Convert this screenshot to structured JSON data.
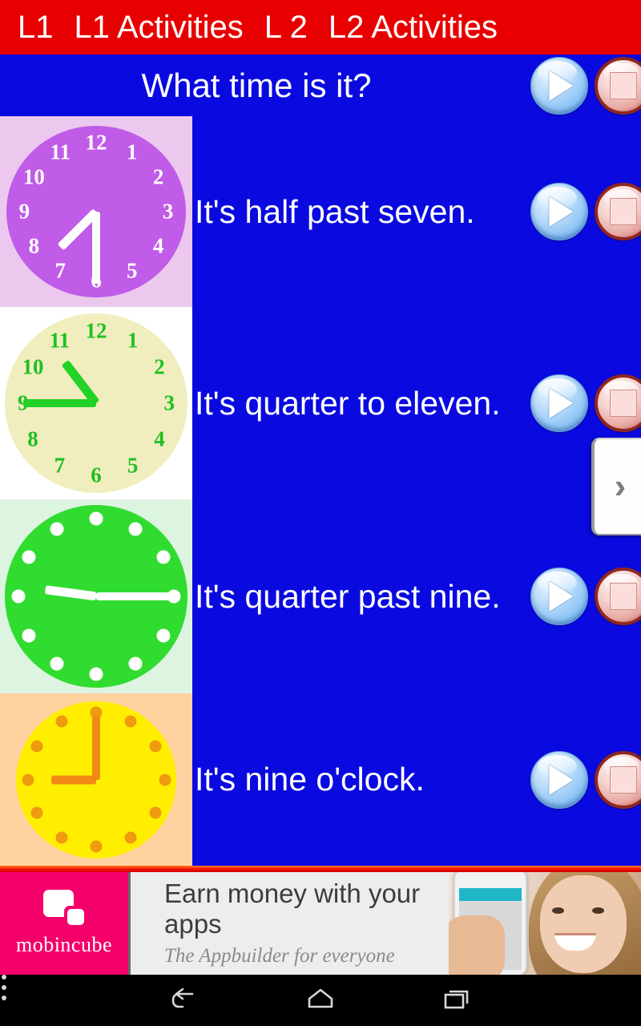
{
  "tabs": [
    {
      "label": "L1"
    },
    {
      "label": "L1 Activities"
    },
    {
      "label": "L 2"
    },
    {
      "label": "L2 Activities"
    }
  ],
  "header": {
    "title": "What time is it?",
    "play_label": "play-icon",
    "stop_label": "stop-icon"
  },
  "drawer": {
    "chevron": "›"
  },
  "rows": [
    {
      "text": "It's half past seven.",
      "clock": {
        "icon": "clock-half-past-seven",
        "background": "#ecc8ee",
        "face": "#c05ce8",
        "marks": "#ffffff",
        "hands": "#ffffff",
        "numerals": [
          "12",
          "1",
          "2",
          "3",
          "4",
          "5",
          "6",
          "7",
          "8",
          "9",
          "10",
          "11"
        ],
        "hour": 7,
        "minute": 30
      }
    },
    {
      "text": "It's quarter to eleven.",
      "clock": {
        "icon": "clock-quarter-to-eleven",
        "background": "#ffffff",
        "face": "#f0eebe",
        "marks": "#1fc022",
        "hands": "#22d226",
        "numerals": [
          "12",
          "1",
          "2",
          "3",
          "4",
          "5",
          "6",
          "7",
          "8",
          "9",
          "10",
          "11"
        ],
        "hour": 10,
        "minute": 45
      }
    },
    {
      "text": "It's quarter past nine.",
      "clock": {
        "icon": "clock-quarter-past-nine",
        "background": "#ddf4e0",
        "face": "#30dc30",
        "marks": "#ffffff",
        "hands": "#ffffff",
        "numerals": [],
        "hour": 9,
        "minute": 15
      }
    },
    {
      "text": "It's nine o'clock.",
      "clock": {
        "icon": "clock-nine-oclock",
        "background": "#ffd2a0",
        "face": "#ffee00",
        "marks": "#f09a10",
        "hands": "#f08a14",
        "numerals": [],
        "hour": 9,
        "minute": 0
      }
    }
  ],
  "ad": {
    "logo_text": "mobincube",
    "headline": "Earn money with your apps",
    "subline": "The Appbuilder for everyone"
  },
  "navbar": {
    "back": "back-icon",
    "home": "home-icon",
    "recent": "recent-apps-icon",
    "menu": "overflow-menu-icon"
  },
  "colors": {
    "tabbar": "#e80000",
    "content": "#0a0ae0",
    "ad_accent": "#f4006b"
  }
}
